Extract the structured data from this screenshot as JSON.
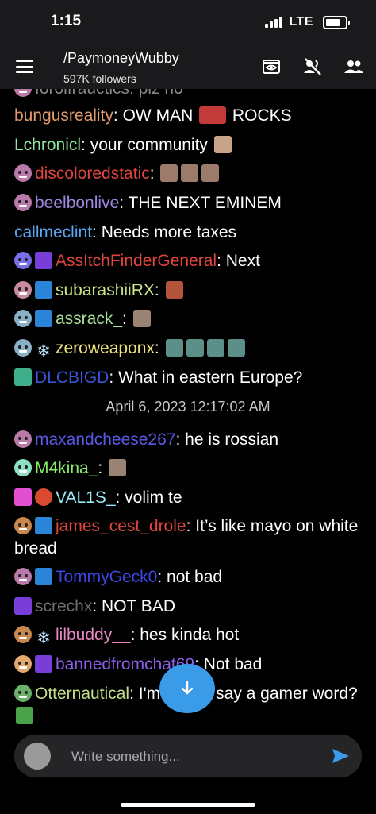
{
  "status": {
    "time": "1:15",
    "network": "LTE"
  },
  "header": {
    "menu_icon": "hamburger-menu-icon",
    "channel": "/PaymoneyWubby",
    "followers": "597K followers",
    "icons": [
      "theater-mode-icon",
      "mute-audio-icon",
      "users-icon"
    ]
  },
  "chat": {
    "partial_top": {
      "user": "forolfrauctics",
      "text": ": plz no"
    },
    "messages": [
      {
        "user": "bungusreality",
        "color": "#e39b6d",
        "text": ": OW MAN ",
        "after": " ROCKS"
      },
      {
        "user": "Lchronicl",
        "color": "#8fe59c",
        "text": ": your community "
      },
      {
        "user": "discoloredstatic",
        "color": "#e0453f",
        "text": ": "
      },
      {
        "user": "beelbonlive",
        "color": "#9c87df",
        "text": ": THE NEXT EMINEM"
      },
      {
        "user": "callmeclint",
        "color": "#5aa5f2",
        "text": ": Needs more taxes"
      },
      {
        "user": "AssItchFinderGeneral",
        "color": "#e0453f",
        "text": ": Next"
      },
      {
        "user": "subarashiiRX",
        "color": "#c8e48a",
        "text": ": "
      },
      {
        "user": "assrack_",
        "color": "#a8e09a",
        "text": ": "
      },
      {
        "user": "zeroweaponx",
        "color": "#f0e27a",
        "text": ": "
      },
      {
        "user": "DLCBIGD",
        "color": "#3b55d6",
        "text": ": What in eastern Europe?"
      },
      {
        "user": "maxandcheese267",
        "color": "#5a59e8",
        "text": ": he is rossian"
      },
      {
        "user": "M4kina_",
        "color": "#86ec6a",
        "text": ": "
      },
      {
        "user": "VAL1S_",
        "color": "#9be6f7",
        "text": ": volim te"
      },
      {
        "user": "james_cest_drole",
        "color": "#e0453f",
        "text": ": It’s like mayo on white bread"
      },
      {
        "user": "TommyGeck0",
        "color": "#3c47e6",
        "text": ": not bad"
      },
      {
        "user": "screchx",
        "color": "#6e6e70",
        "text": ": NOT BAD"
      },
      {
        "user": "lilbuddy__",
        "color": "#e887c2",
        "text": ": hes kinda hot"
      },
      {
        "user": "bannedfromchat69",
        "color": "#8b5fe8",
        "text": ": Not bad"
      },
      {
        "user": "Otternautical",
        "color": "#c5de8a",
        "text": ": I'm gonna say a gamer word? "
      }
    ],
    "timestamp": "April 6, 2023 12:17:02 AM"
  },
  "scroll_button_icon": "arrow-down-icon",
  "composer": {
    "placeholder": "Write something...",
    "send_icon": "send-icon"
  },
  "colors": {
    "accent": "#3a9be8",
    "header_bg": "#1a1a1c",
    "composer_bg": "#252527"
  }
}
